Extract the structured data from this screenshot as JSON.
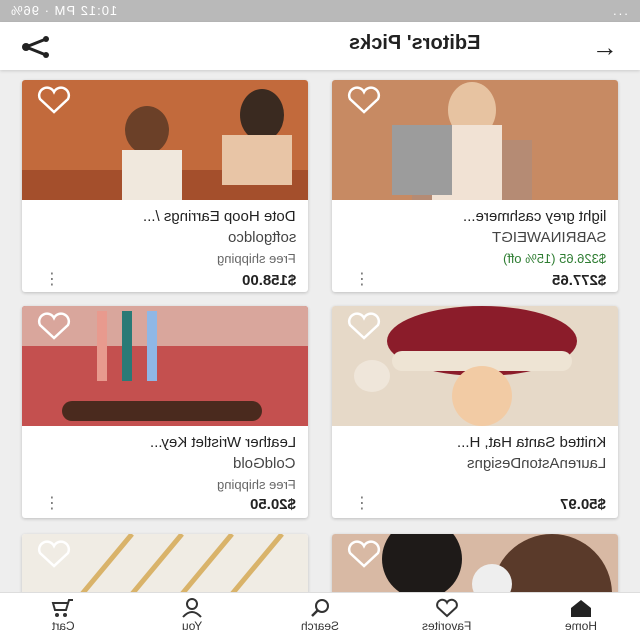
{
  "status_bar": {
    "time": "10:12 PM",
    "battery": "96%",
    "extra": "..."
  },
  "header": {
    "title": "Editors' Picks"
  },
  "products": [
    {
      "name": "light grey cashmere...",
      "shop": "SABRINAWEIGT",
      "sale_price": "$326.65 (15% off)",
      "price": "$277.65",
      "free_shipping": ""
    },
    {
      "name": "Dote Hoop Earrings /...",
      "shop": "softgoldco",
      "sale_price": "",
      "price": "$158.00",
      "free_shipping": "Free shipping"
    },
    {
      "name": "Knitted Santa Hat, H...",
      "shop": "LaurenAstonDesigns",
      "sale_price": "",
      "price": "$50.97",
      "free_shipping": ""
    },
    {
      "name": "Leather Wristlet Key...",
      "shop": "ColdGold",
      "sale_price": "",
      "price": "$20.50",
      "free_shipping": "Free shipping"
    }
  ],
  "bottom_nav": {
    "home": "Home",
    "favorites": "Favorites",
    "search": "Search",
    "you": "You",
    "cart": "Cart"
  },
  "colors": {
    "accent_sale": "#2e7d32",
    "status_bar": "#b9b9b9"
  },
  "icons": [
    "share-icon",
    "back-arrow-icon",
    "heart-icon",
    "home-icon",
    "favorites-icon",
    "search-icon",
    "you-icon",
    "cart-icon",
    "more-menu-icon"
  ]
}
